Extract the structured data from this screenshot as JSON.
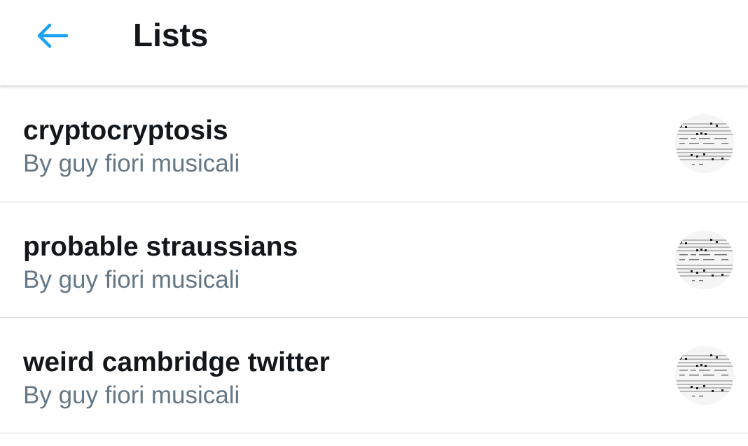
{
  "header": {
    "back_icon": "arrow-left-icon",
    "title": "Lists"
  },
  "colors": {
    "accent": "#1da1f2",
    "text_primary": "#14171a",
    "text_secondary": "#657786",
    "divider": "#d6d9dc"
  },
  "lists": [
    {
      "name": "cryptocryptosis",
      "owner": "By guy fiori musicali",
      "avatar_icon": "sheet-music-thumbnail"
    },
    {
      "name": "probable straussians",
      "owner": "By guy fiori musicali",
      "avatar_icon": "sheet-music-thumbnail"
    },
    {
      "name": "weird cambridge twitter",
      "owner": "By guy fiori musicali",
      "avatar_icon": "sheet-music-thumbnail"
    }
  ]
}
